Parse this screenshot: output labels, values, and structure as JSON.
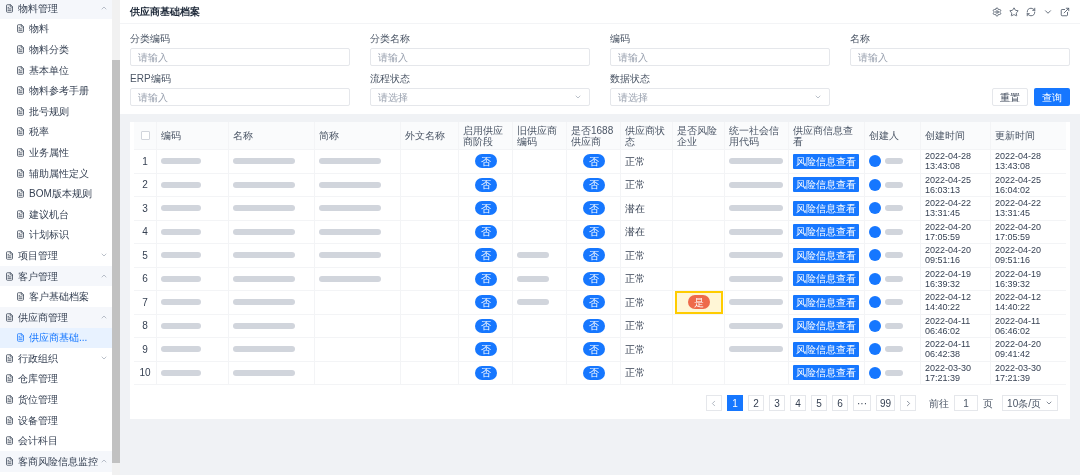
{
  "sidebar": {
    "items": [
      {
        "label": "物料管理",
        "expanded": true,
        "selected": false,
        "children": [
          {
            "label": "物料",
            "selected": false
          },
          {
            "label": "物料分类",
            "selected": false
          },
          {
            "label": "基本单位",
            "selected": false
          },
          {
            "label": "物料参考手册",
            "selected": false
          },
          {
            "label": "批号规则",
            "selected": false
          },
          {
            "label": "税率",
            "selected": false
          },
          {
            "label": "业务属性",
            "selected": false
          },
          {
            "label": "辅助属性定义",
            "selected": false
          },
          {
            "label": "BOM版本规则",
            "selected": false
          },
          {
            "label": "建议机台",
            "selected": false
          },
          {
            "label": "计划标识",
            "selected": false
          }
        ]
      },
      {
        "label": "项目管理",
        "expanded": false,
        "selected": false
      },
      {
        "label": "客户管理",
        "expanded": true,
        "selected": false,
        "children": [
          {
            "label": "客户基础档案",
            "selected": false
          }
        ]
      },
      {
        "label": "供应商管理",
        "expanded": true,
        "selected": false,
        "children": [
          {
            "label": "供应商基础...",
            "selected": true
          }
        ]
      },
      {
        "label": "行政组织",
        "expanded": false,
        "selected": false
      },
      {
        "label": "仓库管理",
        "selected": false
      },
      {
        "label": "货位管理",
        "selected": false
      },
      {
        "label": "设备管理",
        "selected": false
      },
      {
        "label": "会计科目",
        "selected": false
      },
      {
        "label": "客商风险信息监控",
        "expanded": true,
        "selected": false
      }
    ]
  },
  "page": {
    "title": "供应商基础档案"
  },
  "filters": [
    {
      "label": "分类编码",
      "kind": "input",
      "placeholder": "请输入"
    },
    {
      "label": "分类名称",
      "kind": "input",
      "placeholder": "请输入"
    },
    {
      "label": "编码",
      "kind": "input",
      "placeholder": "请输入"
    },
    {
      "label": "名称",
      "kind": "input",
      "placeholder": "请输入"
    },
    {
      "label": "ERP编码",
      "kind": "input",
      "placeholder": "请输入"
    },
    {
      "label": "流程状态",
      "kind": "select",
      "placeholder": "请选择"
    },
    {
      "label": "数据状态",
      "kind": "select",
      "placeholder": "请选择"
    }
  ],
  "buttons": {
    "reset": "重置",
    "query": "查询"
  },
  "table": {
    "select_all": {
      "checked": false
    },
    "columns": [
      "编码",
      "名称",
      "简称",
      "外文名称",
      "启用供应商阶段",
      "旧供应商编码",
      "是否1688供应商",
      "供应商状态",
      "是否风险企业",
      "统一社会信用代码",
      "供应商信息查看",
      "创建人",
      "创建时间",
      "更新时间"
    ],
    "rows": [
      {
        "index": "1",
        "short_name": true,
        "old_code": false,
        "enabled": "否",
        "is1688": "否",
        "status": "正常",
        "credit_code": true,
        "view": "风险信息查看",
        "created": "2022-04-28 13:43:08",
        "updated": "2022-04-28 13:43:08"
      },
      {
        "index": "2",
        "short_name": true,
        "old_code": false,
        "enabled": "否",
        "is1688": "否",
        "status": "正常",
        "credit_code": true,
        "view": "风险信息查看",
        "created": "2022-04-25 16:03:13",
        "updated": "2022-04-25 16:04:02"
      },
      {
        "index": "3",
        "short_name": true,
        "old_code": false,
        "enabled": "否",
        "is1688": "否",
        "status": "潜在",
        "credit_code": true,
        "view": "风险信息查看",
        "created": "2022-04-22 13:31:45",
        "updated": "2022-04-22 13:31:45"
      },
      {
        "index": "4",
        "short_name": true,
        "old_code": false,
        "enabled": "否",
        "is1688": "否",
        "status": "潜在",
        "credit_code": true,
        "view": "风险信息查看",
        "created": "2022-04-20 17:05:59",
        "updated": "2022-04-20 17:05:59"
      },
      {
        "index": "5",
        "short_name": true,
        "old_code": true,
        "enabled": "否",
        "is1688": "否",
        "status": "正常",
        "credit_code": true,
        "view": "风险信息查看",
        "created": "2022-04-20 09:51:16",
        "updated": "2022-04-20 09:51:16"
      },
      {
        "index": "6",
        "short_name": true,
        "old_code": true,
        "enabled": "否",
        "is1688": "否",
        "status": "正常",
        "credit_code": true,
        "view": "风险信息查看",
        "created": "2022-04-19 16:39:32",
        "updated": "2022-04-19 16:39:32"
      },
      {
        "index": "7",
        "short_name": false,
        "old_code": true,
        "enabled": "否",
        "is1688": "否",
        "status": "正常",
        "risk": "是",
        "highlighted": true,
        "credit_code": true,
        "view": "风险信息查看",
        "created": "2022-04-12 14:40:22",
        "updated": "2022-04-12 14:40:22"
      },
      {
        "index": "8",
        "short_name": false,
        "old_code": false,
        "enabled": "否",
        "is1688": "否",
        "status": "正常",
        "credit_code": true,
        "view": "风险信息查看",
        "created": "2022-04-11 06:46:02",
        "updated": "2022-04-11 06:46:02"
      },
      {
        "index": "9",
        "short_name": false,
        "old_code": false,
        "enabled": "否",
        "is1688": "否",
        "status": "正常",
        "credit_code": true,
        "view": "风险信息查看",
        "created": "2022-04-11 06:42:38",
        "updated": "2022-04-20 09:41:42"
      },
      {
        "index": "10",
        "short_name": false,
        "old_code": false,
        "enabled": "否",
        "is1688": "否",
        "status": "正常",
        "credit_code": false,
        "view": "风险信息查看",
        "created": "2022-03-30 17:21:39",
        "updated": "2022-03-30 17:21:39"
      }
    ]
  },
  "pagination": {
    "pages": [
      {
        "label": "1",
        "selected": true
      },
      {
        "label": "2",
        "selected": false
      },
      {
        "label": "3",
        "selected": false
      },
      {
        "label": "4",
        "selected": false
      },
      {
        "label": "5",
        "selected": false
      },
      {
        "label": "6",
        "selected": false
      },
      {
        "label": "···",
        "selected": false
      },
      {
        "label": "99",
        "selected": false
      }
    ],
    "goto_label": "前往",
    "goto_value": "1",
    "page_unit": "页",
    "page_size": "10条/页"
  }
}
